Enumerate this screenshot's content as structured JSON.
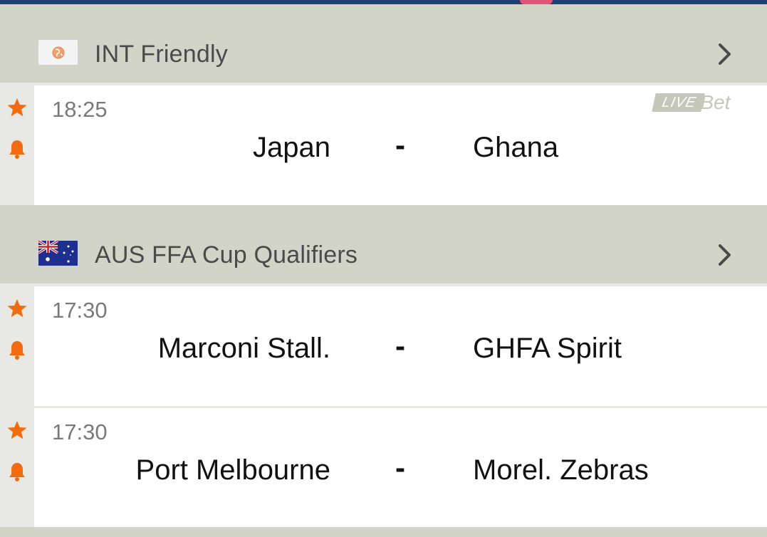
{
  "leagues": [
    {
      "name": "INT Friendly",
      "flag_icon": "globe-icon",
      "matches": [
        {
          "time": "18:25",
          "home": "Japan",
          "separator": "-",
          "away": "Ghana",
          "live_label": "LIVE",
          "bet_label": "Bet"
        }
      ]
    },
    {
      "name": "AUS FFA Cup Qualifiers",
      "flag_icon": "australia-flag-icon",
      "matches": [
        {
          "time": "17:30",
          "home": "Marconi Stall.",
          "separator": "-",
          "away": "GHFA Spirit"
        },
        {
          "time": "17:30",
          "home": "Port Melbourne",
          "separator": "-",
          "away": "Morel. Zebras"
        }
      ]
    }
  ],
  "colors": {
    "accent_orange": "#f26b0f",
    "header_bg": "#d3d4c8",
    "live_badge": "#c6c7bb",
    "top_bar": "#1f3f74"
  }
}
